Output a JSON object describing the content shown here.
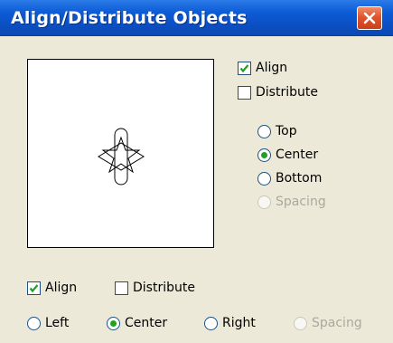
{
  "window": {
    "title": "Align/Distribute Objects",
    "close_icon": "close-icon"
  },
  "vertical": {
    "align_label": "Align",
    "align_checked": true,
    "distribute_label": "Distribute",
    "distribute_checked": false,
    "options": [
      {
        "label": "Top",
        "selected": false,
        "enabled": true
      },
      {
        "label": "Center",
        "selected": true,
        "enabled": true
      },
      {
        "label": "Bottom",
        "selected": false,
        "enabled": true
      },
      {
        "label": "Spacing",
        "selected": false,
        "enabled": false
      }
    ]
  },
  "horizontal": {
    "align_label": "Align",
    "align_checked": true,
    "distribute_label": "Distribute",
    "distribute_checked": false,
    "options": [
      {
        "label": "Left",
        "selected": false,
        "enabled": true
      },
      {
        "label": "Center",
        "selected": true,
        "enabled": true
      },
      {
        "label": "Right",
        "selected": false,
        "enabled": true
      },
      {
        "label": "Spacing",
        "selected": false,
        "enabled": false
      }
    ]
  },
  "colors": {
    "check_green": "#21a121",
    "radio_dot_green": "#21a121",
    "disabled_text": "#aaa9a0"
  }
}
